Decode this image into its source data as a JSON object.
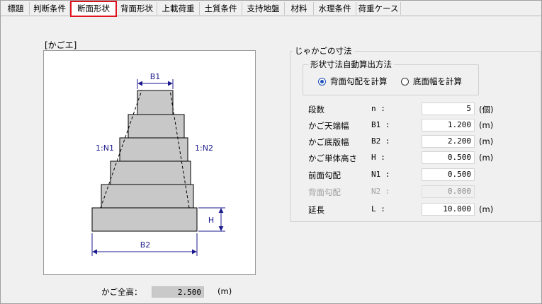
{
  "tabs": [
    {
      "label": "標題",
      "active": false
    },
    {
      "label": "判断条件",
      "active": false
    },
    {
      "label": "断面形状",
      "active": true
    },
    {
      "label": "背面形状",
      "active": false
    },
    {
      "label": "上載荷重",
      "active": false
    },
    {
      "label": "土質条件",
      "active": false
    },
    {
      "label": "支持地盤",
      "active": false
    },
    {
      "label": "材料",
      "active": false
    },
    {
      "label": "水理条件",
      "active": false
    },
    {
      "label": "荷重ケース",
      "active": false
    }
  ],
  "diagram": {
    "title": "[かごエ]",
    "labels": {
      "b1": "B1",
      "b2": "B2",
      "n1": "1:N1",
      "n2": "1:N2",
      "h": "H"
    },
    "tiers": 6,
    "colors": {
      "fill": "#c8c8c8",
      "stroke": "#000000",
      "dimension": "#1a1a8c"
    }
  },
  "total": {
    "label": "かご全高：",
    "value": "2.500",
    "unit": "(m)"
  },
  "dimensions_group": {
    "title": "じゃかごの寸法",
    "method": {
      "title": "形状寸法自動算出方法",
      "options": [
        {
          "label": "背面勾配を計算",
          "selected": true
        },
        {
          "label": "底面幅を計算",
          "selected": false
        }
      ]
    },
    "fields": [
      {
        "label": "段数",
        "symbol": "n :",
        "value": "5",
        "unit": "(個)",
        "enabled": true
      },
      {
        "label": "かご天端幅",
        "symbol": "B1 :",
        "value": "1.200",
        "unit": "(m)",
        "enabled": true
      },
      {
        "label": "かご底版幅",
        "symbol": "B2 :",
        "value": "2.200",
        "unit": "(m)",
        "enabled": true
      },
      {
        "label": "かご単体高さ",
        "symbol": "H :",
        "value": "0.500",
        "unit": "(m)",
        "enabled": true
      },
      {
        "label": "前面勾配",
        "symbol": "N1 :",
        "value": "0.500",
        "unit": "",
        "enabled": true
      },
      {
        "label": "背面勾配",
        "symbol": "N2 :",
        "value": "0.000",
        "unit": "",
        "enabled": false
      },
      {
        "label": "延長",
        "symbol": "L :",
        "value": "10.000",
        "unit": "(m)",
        "enabled": true
      }
    ]
  },
  "colors": {
    "accent_tab_border": "#e0141e",
    "radio_selected": "#1b4fb8"
  }
}
